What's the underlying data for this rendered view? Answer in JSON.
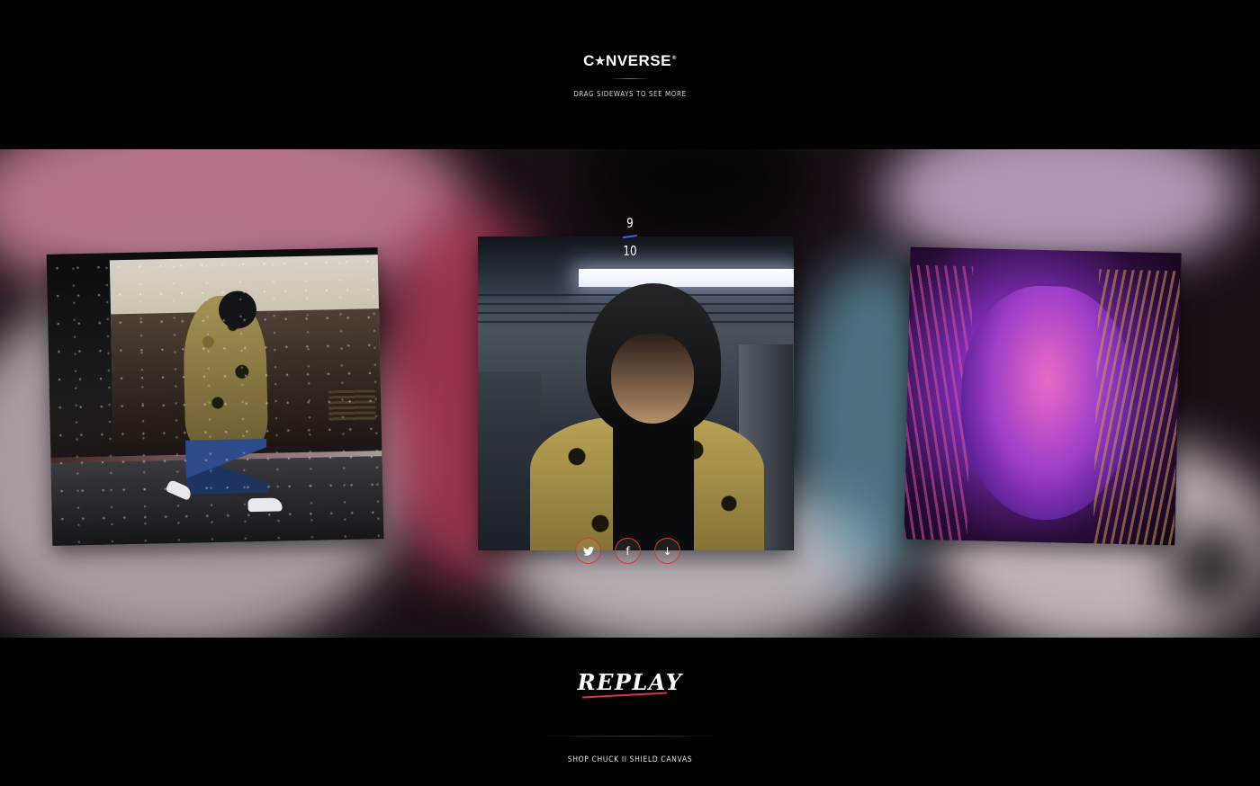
{
  "header": {
    "logo_text": "CONVERSE",
    "logo_star": "★",
    "logo_reg": "®",
    "drag_hint": "DRAG SIDEWAYS TO SEE MORE"
  },
  "gallery": {
    "current": "9",
    "total": "10",
    "accent_color": "#3c5ee0",
    "share_buttons": [
      {
        "icon": "twitter-icon",
        "glyph": "🐦"
      },
      {
        "icon": "facebook-icon",
        "glyph": "f"
      },
      {
        "icon": "download-icon",
        "glyph": "↓"
      }
    ],
    "share_border_color": "#e0323a"
  },
  "footer": {
    "replay_logo": "REPLAY",
    "shop_link": "SHOP CHUCK II SHIELD CANVAS"
  }
}
